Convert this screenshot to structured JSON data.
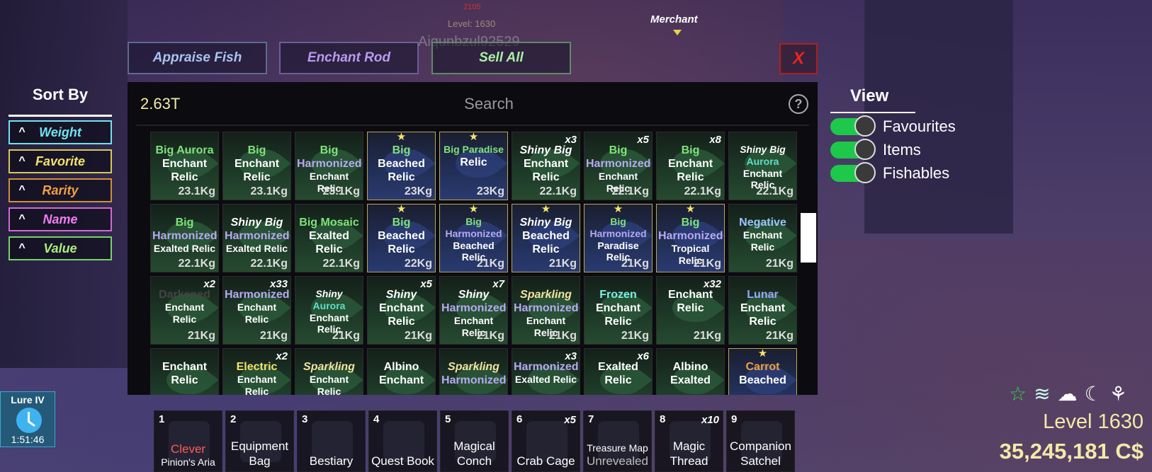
{
  "world": {
    "player_name": "Aiqunbzul92529",
    "player_level_tag": "Level: 1630",
    "damage_tag": "2105",
    "merchant_label": "Merchant"
  },
  "top_buttons": {
    "appraise": "Appraise Fish",
    "enchant": "Enchant Rod",
    "sell": "Sell All",
    "close": "X"
  },
  "sort": {
    "title": "Sort By",
    "options": [
      {
        "label": "Weight",
        "color": "#6fe3ef",
        "border": "#6fe3ef",
        "arrow": "^"
      },
      {
        "label": "Favorite",
        "color": "#f3e26a",
        "border": "#d8c85a",
        "arrow": "^"
      },
      {
        "label": "Rarity",
        "color": "#f0a040",
        "border": "#d0903a",
        "arrow": "^"
      },
      {
        "label": "Name",
        "color": "#f07af0",
        "border": "#d06ad0",
        "arrow": "^"
      },
      {
        "label": "Value",
        "color": "#a9f07a",
        "border": "#7ad06a",
        "arrow": "^"
      }
    ]
  },
  "inventory": {
    "total": "2.63T",
    "search_placeholder": "Search",
    "help": "?",
    "items": [
      {
        "lines": [
          [
            "Big Aurora",
            "mod-green"
          ],
          [
            "Enchant",
            "mod-white"
          ],
          [
            "Relic",
            "mod-white"
          ]
        ],
        "weight": "23.1Kg",
        "fav": false,
        "count": ""
      },
      {
        "lines": [
          [
            "Big",
            "mod-green"
          ],
          [
            "Enchant",
            "mod-white"
          ],
          [
            "Relic",
            "mod-white"
          ]
        ],
        "weight": "23.1Kg",
        "fav": false,
        "count": ""
      },
      {
        "lines": [
          [
            "Big",
            "mod-green"
          ],
          [
            "Harmonized",
            "mod-purple"
          ],
          [
            "Enchant Relic",
            "mod-white"
          ]
        ],
        "weight": "23.1Kg",
        "fav": false,
        "count": ""
      },
      {
        "lines": [
          [
            "Big",
            "mod-green"
          ],
          [
            "Beached",
            "mod-white"
          ],
          [
            "Relic",
            "mod-white"
          ]
        ],
        "weight": "23Kg",
        "fav": true,
        "count": ""
      },
      {
        "lines": [
          [
            "Big Paradise",
            "mod-green"
          ],
          [
            "Relic",
            "mod-white"
          ]
        ],
        "weight": "23Kg",
        "fav": true,
        "count": ""
      },
      {
        "lines": [
          [
            "Shiny Big",
            "mod-shiny"
          ],
          [
            "Enchant",
            "mod-white"
          ],
          [
            "Relic",
            "mod-white"
          ]
        ],
        "weight": "22.1Kg",
        "fav": false,
        "count": "x3"
      },
      {
        "lines": [
          [
            "Big",
            "mod-green"
          ],
          [
            "Harmonized",
            "mod-purple"
          ],
          [
            "Enchant Relic",
            "mod-white"
          ]
        ],
        "weight": "22.1Kg",
        "fav": false,
        "count": "x5"
      },
      {
        "lines": [
          [
            "Big",
            "mod-green"
          ],
          [
            "Enchant",
            "mod-white"
          ],
          [
            "Relic",
            "mod-white"
          ]
        ],
        "weight": "22.1Kg",
        "fav": false,
        "count": "x8"
      },
      {
        "lines": [
          [
            "Shiny Big",
            "mod-shiny"
          ],
          [
            "Aurora",
            "mod-aurora"
          ],
          [
            "Enchant",
            "mod-white"
          ],
          [
            "Relic",
            "mod-white"
          ]
        ],
        "weight": "22.1Kg",
        "fav": false,
        "count": ""
      },
      {
        "lines": [
          [
            "Big",
            "mod-green"
          ],
          [
            "Harmonized",
            "mod-purple"
          ],
          [
            "Exalted Relic",
            "mod-white"
          ]
        ],
        "weight": "22.1Kg",
        "fav": false,
        "count": ""
      },
      {
        "lines": [
          [
            "Shiny Big",
            "mod-shiny"
          ],
          [
            "Harmonized",
            "mod-purple"
          ],
          [
            "Exalted Relic",
            "mod-white"
          ]
        ],
        "weight": "22.1Kg",
        "fav": false,
        "count": ""
      },
      {
        "lines": [
          [
            "Big Mosaic",
            "mod-green"
          ],
          [
            "Exalted",
            "mod-white"
          ],
          [
            "Relic",
            "mod-white"
          ]
        ],
        "weight": "22.1Kg",
        "fav": false,
        "count": ""
      },
      {
        "lines": [
          [
            "Big",
            "mod-green"
          ],
          [
            "Beached",
            "mod-white"
          ],
          [
            "Relic",
            "mod-white"
          ]
        ],
        "weight": "22Kg",
        "fav": true,
        "count": ""
      },
      {
        "lines": [
          [
            "Big",
            "mod-green"
          ],
          [
            "Harmonized",
            "mod-purple"
          ],
          [
            "Beached",
            "mod-white"
          ],
          [
            "Relic",
            "mod-white"
          ]
        ],
        "weight": "21Kg",
        "fav": true,
        "count": ""
      },
      {
        "lines": [
          [
            "Shiny Big",
            "mod-shiny"
          ],
          [
            "Beached",
            "mod-white"
          ],
          [
            "Relic",
            "mod-white"
          ]
        ],
        "weight": "21Kg",
        "fav": true,
        "count": ""
      },
      {
        "lines": [
          [
            "Big",
            "mod-green"
          ],
          [
            "Harmonized",
            "mod-purple"
          ],
          [
            "Paradise",
            "mod-white"
          ],
          [
            "Relic",
            "mod-white"
          ]
        ],
        "weight": "21Kg",
        "fav": true,
        "count": ""
      },
      {
        "lines": [
          [
            "Big",
            "mod-green"
          ],
          [
            "Harmonized",
            "mod-purple"
          ],
          [
            "Tropical Relic",
            "mod-white"
          ]
        ],
        "weight": "21Kg",
        "fav": true,
        "count": ""
      },
      {
        "lines": [
          [
            "Negative",
            "mod-blue"
          ],
          [
            "Enchant Relic",
            "mod-white"
          ]
        ],
        "weight": "21Kg",
        "fav": false,
        "count": ""
      },
      {
        "lines": [
          [
            "Darkened",
            "mod-dark"
          ],
          [
            "Enchant Relic",
            "mod-white"
          ]
        ],
        "weight": "21Kg",
        "fav": false,
        "count": "x2"
      },
      {
        "lines": [
          [
            "Harmonized",
            "mod-purple"
          ],
          [
            "Enchant Relic",
            "mod-white"
          ]
        ],
        "weight": "21Kg",
        "fav": false,
        "count": "x33"
      },
      {
        "lines": [
          [
            "Shiny",
            "mod-shiny"
          ],
          [
            "Aurora",
            "mod-aurora"
          ],
          [
            "Enchant",
            "mod-white"
          ],
          [
            "Relic",
            "mod-white"
          ]
        ],
        "weight": "21Kg",
        "fav": false,
        "count": ""
      },
      {
        "lines": [
          [
            "Shiny",
            "mod-shiny"
          ],
          [
            "Enchant",
            "mod-white"
          ],
          [
            "Relic",
            "mod-white"
          ]
        ],
        "weight": "21Kg",
        "fav": false,
        "count": "x5"
      },
      {
        "lines": [
          [
            "Shiny",
            "mod-shiny"
          ],
          [
            "Harmonized",
            "mod-purple"
          ],
          [
            "Enchant Relic",
            "mod-white"
          ]
        ],
        "weight": "21Kg",
        "fav": false,
        "count": "x7"
      },
      {
        "lines": [
          [
            "Sparkling",
            "mod-sparkle"
          ],
          [
            "Harmonized",
            "mod-purple"
          ],
          [
            "Enchant Relic",
            "mod-white"
          ]
        ],
        "weight": "21Kg",
        "fav": false,
        "count": ""
      },
      {
        "lines": [
          [
            "Frozen",
            "mod-frozen"
          ],
          [
            "Enchant",
            "mod-white"
          ],
          [
            "Relic",
            "mod-white"
          ]
        ],
        "weight": "21Kg",
        "fav": false,
        "count": ""
      },
      {
        "lines": [
          [
            "Enchant",
            "mod-white"
          ],
          [
            "Relic",
            "mod-white"
          ]
        ],
        "weight": "21Kg",
        "fav": false,
        "count": "x32"
      },
      {
        "lines": [
          [
            "Lunar",
            "mod-lunar"
          ],
          [
            "Enchant",
            "mod-white"
          ],
          [
            "Relic",
            "mod-white"
          ]
        ],
        "weight": "21Kg",
        "fav": false,
        "count": ""
      },
      {
        "lines": [
          [
            "Enchant",
            "mod-white"
          ],
          [
            "Relic",
            "mod-white"
          ]
        ],
        "weight": "",
        "fav": false,
        "count": ""
      },
      {
        "lines": [
          [
            "Electric",
            "mod-yellow"
          ],
          [
            "Enchant Relic",
            "mod-white"
          ]
        ],
        "weight": "",
        "fav": false,
        "count": "x2"
      },
      {
        "lines": [
          [
            "Sparkling",
            "mod-sparkle"
          ],
          [
            "Enchant Relic",
            "mod-white"
          ]
        ],
        "weight": "",
        "fav": false,
        "count": ""
      },
      {
        "lines": [
          [
            "Albino",
            "mod-white"
          ],
          [
            "Enchant",
            "mod-white"
          ]
        ],
        "weight": "",
        "fav": false,
        "count": ""
      },
      {
        "lines": [
          [
            "Sparkling",
            "mod-sparkle"
          ],
          [
            "Harmonized",
            "mod-purple"
          ]
        ],
        "weight": "",
        "fav": false,
        "count": ""
      },
      {
        "lines": [
          [
            "Harmonized",
            "mod-purple"
          ],
          [
            "Exalted Relic",
            "mod-white"
          ]
        ],
        "weight": "",
        "fav": false,
        "count": "x3"
      },
      {
        "lines": [
          [
            "Exalted",
            "mod-white"
          ],
          [
            "Relic",
            "mod-white"
          ]
        ],
        "weight": "",
        "fav": false,
        "count": "x6"
      },
      {
        "lines": [
          [
            "Albino",
            "mod-white"
          ],
          [
            "Exalted",
            "mod-white"
          ]
        ],
        "weight": "",
        "fav": false,
        "count": ""
      },
      {
        "lines": [
          [
            "Carrot",
            "mod-orange"
          ],
          [
            "Beached",
            "mod-white"
          ]
        ],
        "weight": "",
        "fav": true,
        "count": ""
      }
    ]
  },
  "view": {
    "title": "View",
    "toggles": [
      {
        "label": "Favourites",
        "on": true
      },
      {
        "label": "Items",
        "on": true
      },
      {
        "label": "Fishables",
        "on": true
      }
    ]
  },
  "hotbar": [
    {
      "num": "1",
      "label": "Clever",
      "label2": "Pinion's Aria",
      "color": "#ff5a5a",
      "count": "",
      "icon": "rod-icon"
    },
    {
      "num": "2",
      "label": "Equipment",
      "label2": "Bag",
      "color": "#fff",
      "count": "",
      "icon": "bag-icon"
    },
    {
      "num": "3",
      "label": "Bestiary",
      "label2": "",
      "color": "#fff",
      "count": "",
      "icon": "book-icon"
    },
    {
      "num": "4",
      "label": "Quest Book",
      "label2": "",
      "color": "#fff",
      "count": "",
      "icon": "quest-book-icon"
    },
    {
      "num": "5",
      "label": "Magical",
      "label2": "Conch",
      "color": "#fff",
      "count": "",
      "icon": "conch-icon"
    },
    {
      "num": "6",
      "label": "Crab Cage",
      "label2": "",
      "color": "#fff",
      "count": "x5",
      "icon": "crab-cage-icon"
    },
    {
      "num": "7",
      "label": "Treasure Map",
      "label2": "Unrevealed",
      "color": "#fff",
      "count": "",
      "icon": "map-icon"
    },
    {
      "num": "8",
      "label": "Magic",
      "label2": "Thread",
      "color": "#fff",
      "count": "x10",
      "icon": "thread-icon"
    },
    {
      "num": "9",
      "label": "Companion",
      "label2": "Satchel",
      "color": "#fff",
      "count": "",
      "icon": "satchel-icon"
    }
  ],
  "lure": {
    "title": "Lure IV",
    "time": "1:51:46"
  },
  "status": {
    "level": "Level 1630",
    "money": "35,245,181 C$"
  }
}
